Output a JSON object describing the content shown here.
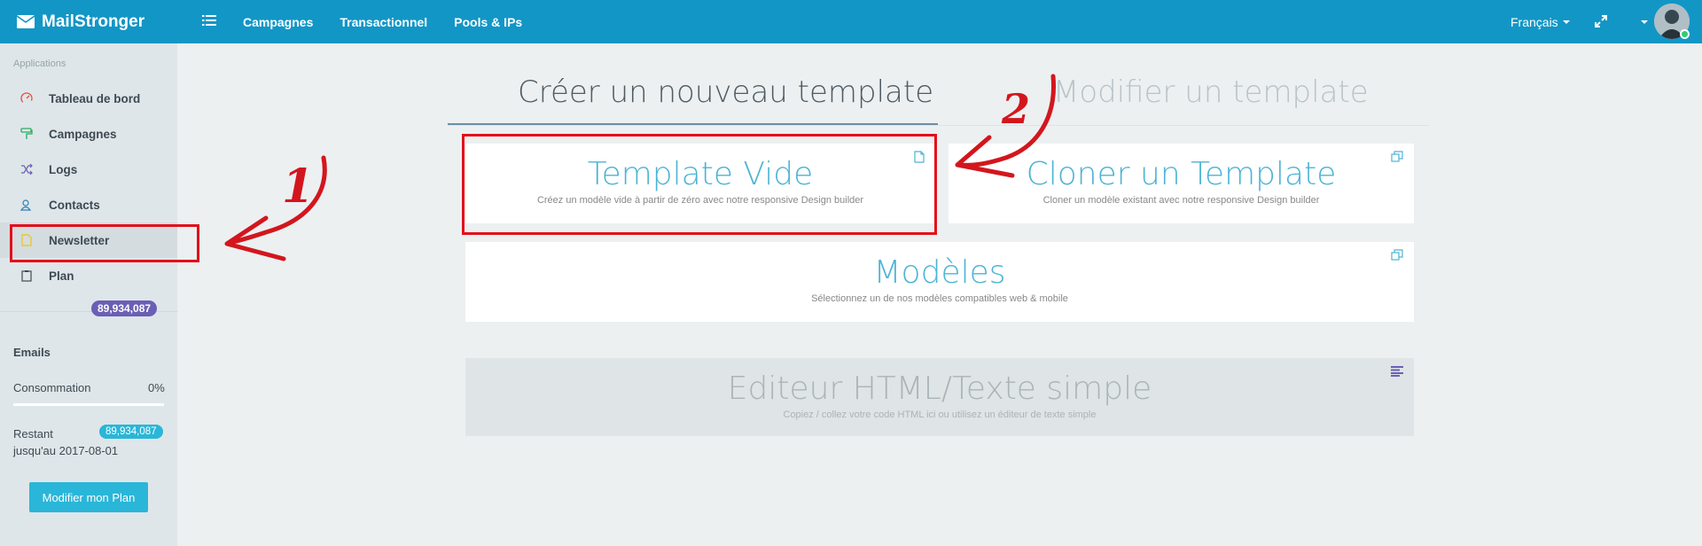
{
  "header": {
    "brand": "MailStronger",
    "nav": [
      "Campagnes",
      "Transactionnel",
      "Pools & IPs"
    ],
    "language": "Français"
  },
  "sidebar": {
    "heading": "Applications",
    "items": [
      {
        "label": "Tableau de bord",
        "icon": "dashboard-icon",
        "color": "#e74c3c"
      },
      {
        "label": "Campagnes",
        "icon": "paint-roller-icon",
        "color": "#27ae60"
      },
      {
        "label": "Logs",
        "icon": "shuffle-icon",
        "color": "#6b5fb5"
      },
      {
        "label": "Contacts",
        "icon": "contacts-icon",
        "color": "#2980b9"
      },
      {
        "label": "Newsletter",
        "icon": "document-icon",
        "color": "#f1c40f"
      },
      {
        "label": "Plan",
        "icon": "clipboard-icon",
        "color": "#3d4a52"
      }
    ],
    "stats": {
      "emails_label": "Emails",
      "emails_value": "89,934,087",
      "consumption_label": "Consommation",
      "consumption_value": "0%",
      "remaining_label": "Restant",
      "remaining_until": "jusqu'au 2017-08-01",
      "remaining_value": "89,934,087"
    },
    "plan_button": "Modifier mon Plan"
  },
  "tabs": {
    "create": "Créer un nouveau template",
    "edit": "Modifier un template"
  },
  "cards": {
    "blank": {
      "title": "Template Vide",
      "sub": "Créez un modèle vide à partir de zéro avec notre responsive Design builder"
    },
    "clone": {
      "title": "Cloner un Template",
      "sub": "Cloner un modèle existant avec notre responsive Design builder"
    },
    "models": {
      "title": "Modèles",
      "sub": "Sélectionnez un de nos modèles compatibles web & mobile"
    },
    "html": {
      "title": "Editeur HTML/Texte simple",
      "sub": "Copiez / collez votre code HTML ici ou utilisez un éditeur de texte simple"
    }
  },
  "annotations": [
    "1",
    "2"
  ],
  "colors": {
    "topbar": "#1296c6",
    "accent": "#29b6d8",
    "highlight": "#e3101a"
  }
}
